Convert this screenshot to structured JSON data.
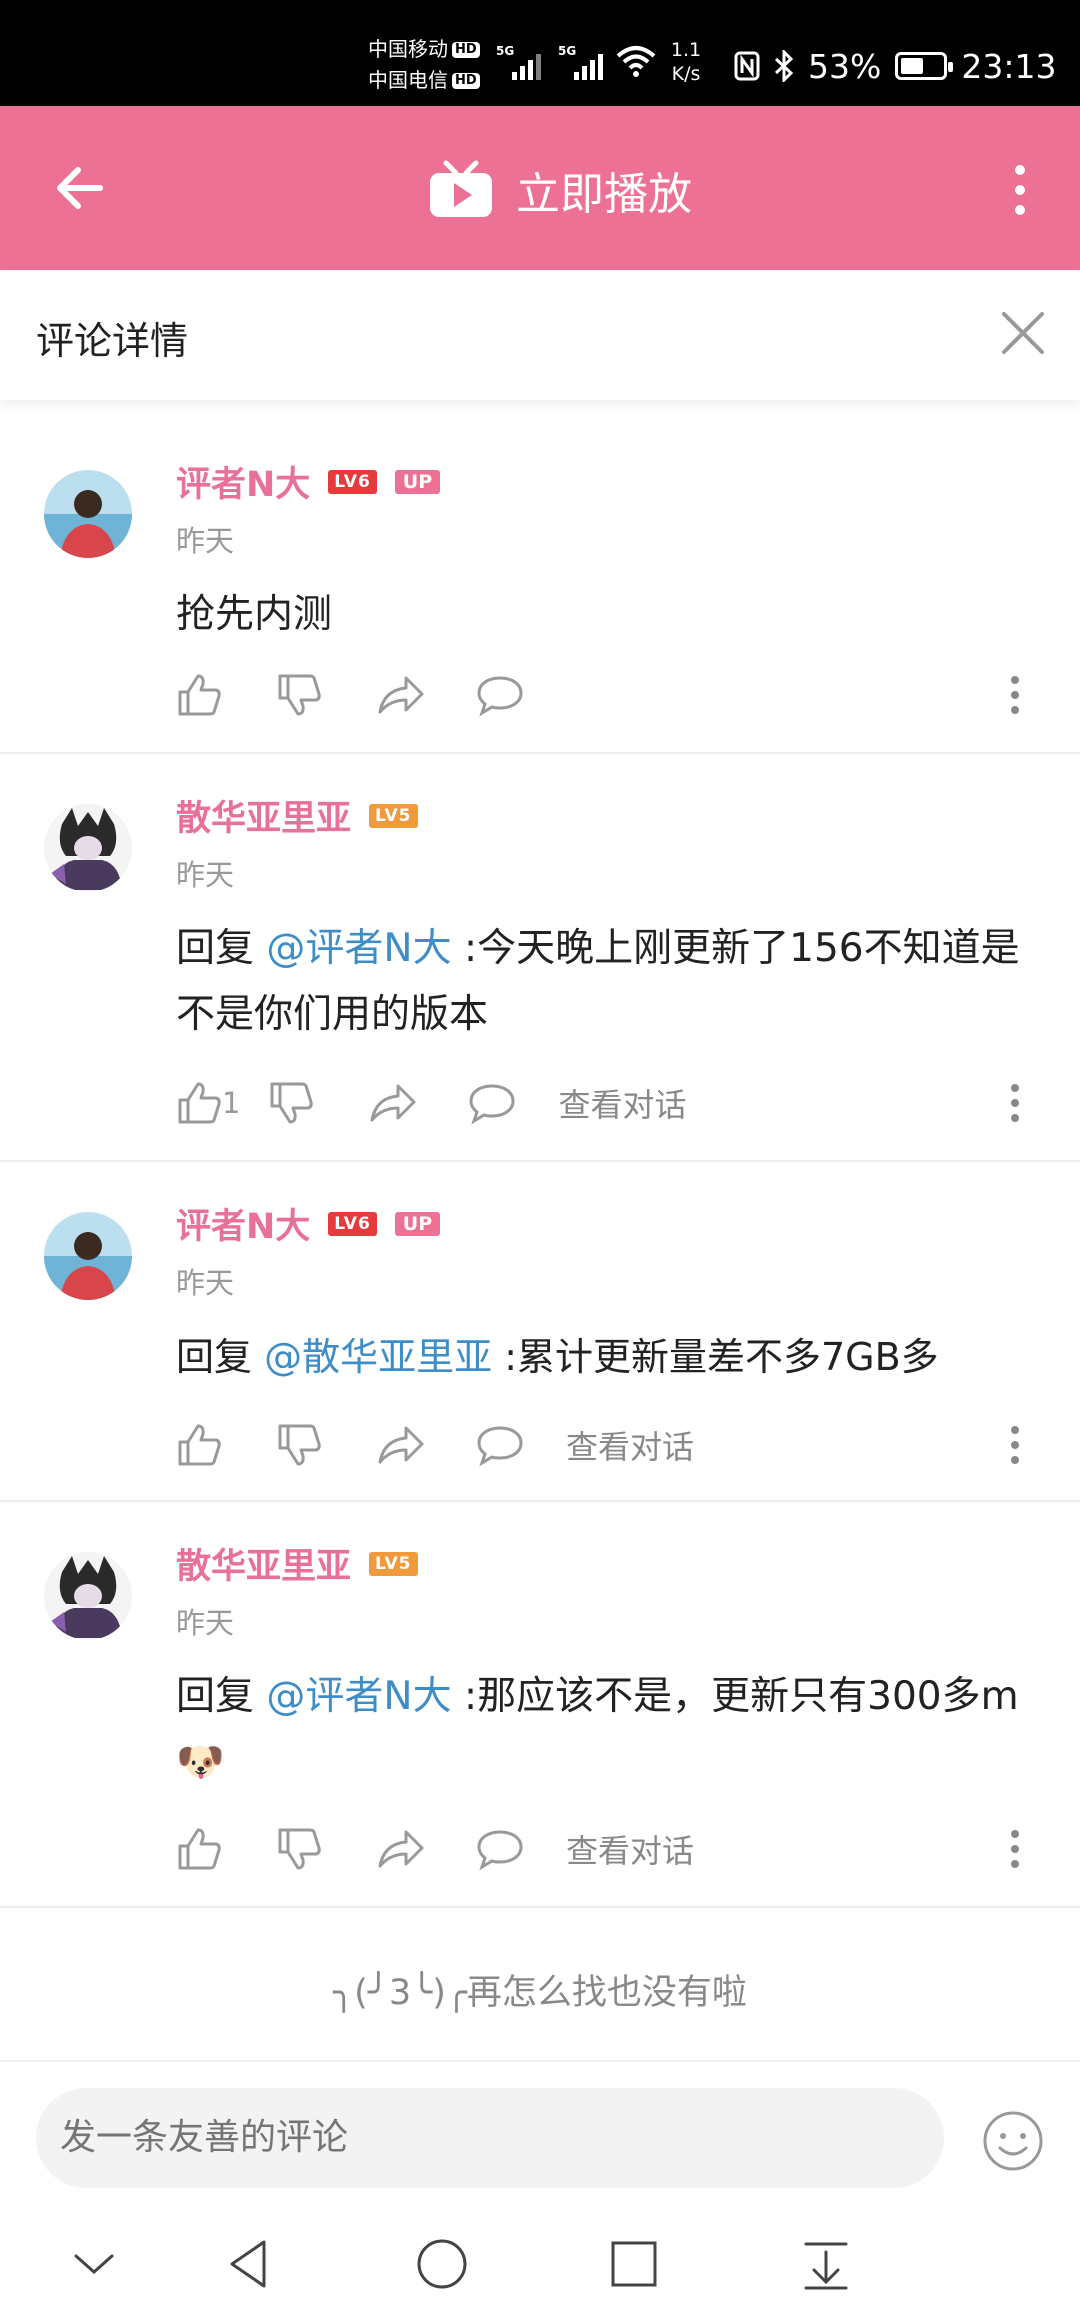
{
  "status_bar": {
    "carrier1": "中国移动",
    "carrier2": "中国电信",
    "hd_label": "HD",
    "signal1_tag": "5G",
    "signal2_tag": "5G",
    "speed_top": "1.1",
    "speed_bottom": "K/s",
    "battery": "53%",
    "time": "23:13"
  },
  "appbar": {
    "title": "立即播放",
    "accent": "#ed7195"
  },
  "detail": {
    "title": "评论详情"
  },
  "comments": [
    {
      "user": "评者N大",
      "level": "LV6",
      "up": "UP",
      "time": "昨天",
      "text_plain": "抢先内测"
    },
    {
      "user": "散华亚里亚",
      "level": "LV5",
      "time": "昨天",
      "reply_prefix": "回复 ",
      "mention": "@评者N大",
      "text": " :今天晚上刚更新了156不知道是不是你们用的版本",
      "like_count": "1",
      "view_conversation": "查看对话"
    },
    {
      "user": "评者N大",
      "level": "LV6",
      "up": "UP",
      "time": "昨天",
      "reply_prefix": "回复 ",
      "mention": "@散华亚里亚",
      "text": " :累计更新量差不多7GB多",
      "view_conversation": "查看对话"
    },
    {
      "user": "散华亚里亚",
      "level": "LV5",
      "time": "昨天",
      "reply_prefix": "回复 ",
      "mention": "@评者N大",
      "text": " :那应该不是，更新只有300多m",
      "emoji": "🐶",
      "view_conversation": "查看对话"
    }
  ],
  "end_text": "╮(╯3╰)╭再怎么找也没有啦",
  "input": {
    "placeholder": "发一条友善的评论"
  },
  "icons": {
    "back": "arrow-left-icon",
    "tv": "tv-play-icon",
    "more": "more-vertical-icon",
    "close": "close-icon",
    "like": "thumb-up-icon",
    "dislike": "thumb-down-icon",
    "share": "share-arrow-icon",
    "comment": "comment-bubble-icon",
    "emoji": "emoji-face-icon"
  }
}
